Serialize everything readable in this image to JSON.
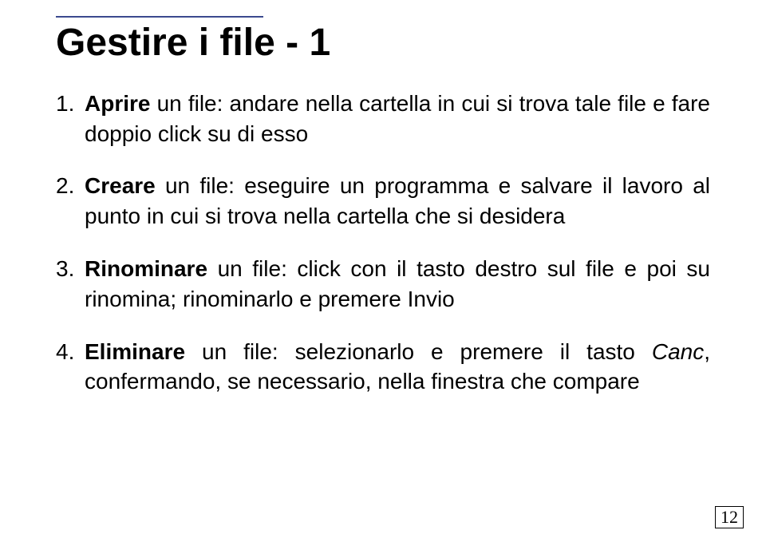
{
  "title": "Gestire i file - 1",
  "items": [
    {
      "lead": "Aprire",
      "rest": " un file: andare nella cartella in cui si trova tale file e fare doppio click su di esso",
      "tail_italic": ""
    },
    {
      "lead": "Creare",
      "rest": " un file: eseguire un programma e salvare il lavoro al punto in cui si trova nella cartella che si desidera",
      "tail_italic": ""
    },
    {
      "lead": "Rinominare",
      "rest": " un file: click con il tasto destro sul file e poi su rinomina; rinominarlo e premere Invio",
      "tail_italic": ""
    },
    {
      "lead": "Eliminare",
      "rest": " un file: selezionarlo e premere il tasto ",
      "tail_italic": "Canc",
      "after_italic": ", confermando, se necessario, nella finestra che compare"
    }
  ],
  "page_number": "12"
}
